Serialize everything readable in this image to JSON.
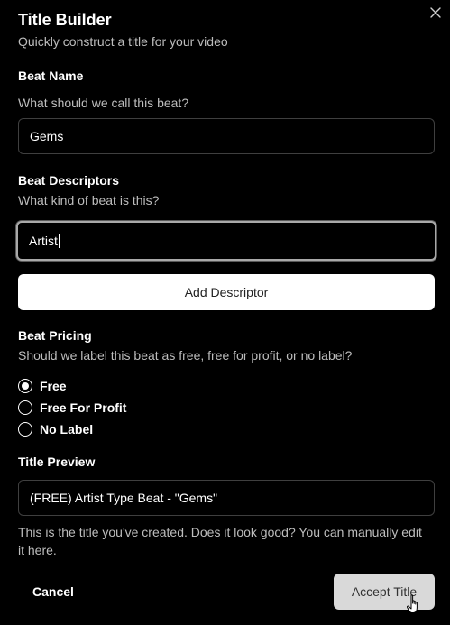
{
  "dialog": {
    "title": "Title Builder",
    "subtitle": "Quickly construct a title for your video"
  },
  "beat_name": {
    "label": "Beat Name",
    "help": "What should we call this beat?",
    "value": "Gems"
  },
  "beat_descriptors": {
    "label": "Beat Descriptors",
    "help": "What kind of beat is this?",
    "value": "Artist",
    "add_label": "Add Descriptor"
  },
  "beat_pricing": {
    "label": "Beat Pricing",
    "help": "Should we label this beat as free, free for profit, or no label?",
    "options": [
      {
        "label": "Free",
        "selected": true
      },
      {
        "label": "Free For Profit",
        "selected": false
      },
      {
        "label": "No Label",
        "selected": false
      }
    ]
  },
  "title_preview": {
    "label": "Title Preview",
    "value": "(FREE) Artist Type Beat - \"Gems\"",
    "help": "This is the title you've created. Does it look good? You can manually edit it here."
  },
  "actions": {
    "cancel_label": "Cancel",
    "accept_label": "Accept Title"
  },
  "icons": {
    "close": "close-icon",
    "cursor": "hand-pointer-icon"
  },
  "colors": {
    "background": "#000000",
    "primary_button": "#ffffff",
    "accept_button_hover": "#d9d9d9",
    "input_border": "#3f3f3f",
    "focus_ring": "#a9a9a9",
    "muted_text": "#bdbdbd"
  }
}
